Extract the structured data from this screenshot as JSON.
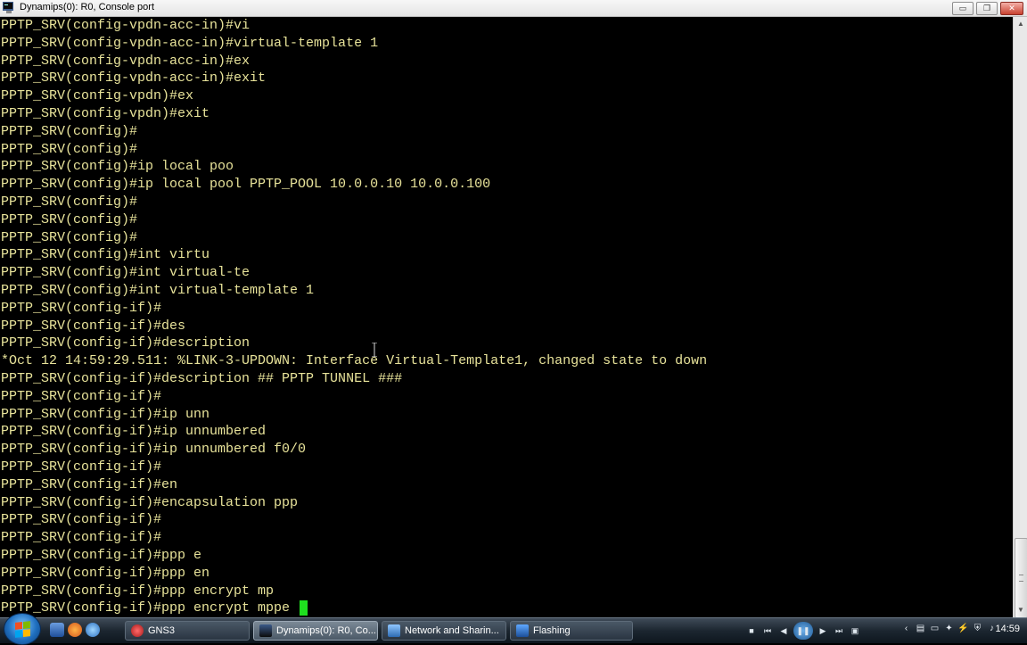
{
  "window": {
    "title": "Dynamips(0): R0, Console port",
    "minimize_glyph": "▭",
    "maximize_glyph": "❐",
    "close_glyph": "✕"
  },
  "console": {
    "lines": [
      "PPTP_SRV(config-vpdn-acc-in)#vi",
      "PPTP_SRV(config-vpdn-acc-in)#virtual-template 1",
      "PPTP_SRV(config-vpdn-acc-in)#ex",
      "PPTP_SRV(config-vpdn-acc-in)#exit",
      "PPTP_SRV(config-vpdn)#ex",
      "PPTP_SRV(config-vpdn)#exit",
      "PPTP_SRV(config)#",
      "PPTP_SRV(config)#",
      "PPTP_SRV(config)#ip local poo",
      "PPTP_SRV(config)#ip local pool PPTP_POOL 10.0.0.10 10.0.0.100",
      "PPTP_SRV(config)#",
      "PPTP_SRV(config)#",
      "PPTP_SRV(config)#",
      "PPTP_SRV(config)#int virtu",
      "PPTP_SRV(config)#int virtual-te",
      "PPTP_SRV(config)#int virtual-template 1",
      "PPTP_SRV(config-if)#",
      "PPTP_SRV(config-if)#des",
      "PPTP_SRV(config-if)#description",
      "*Oct 12 14:59:29.511: %LINK-3-UPDOWN: Interface Virtual-Template1, changed state to down",
      "PPTP_SRV(config-if)#description ## PPTP TUNNEL ###",
      "PPTP_SRV(config-if)#",
      "PPTP_SRV(config-if)#ip unn",
      "PPTP_SRV(config-if)#ip unnumbered",
      "PPTP_SRV(config-if)#ip unnumbered f0/0",
      "PPTP_SRV(config-if)#",
      "PPTP_SRV(config-if)#en",
      "PPTP_SRV(config-if)#encapsulation ppp",
      "PPTP_SRV(config-if)#",
      "PPTP_SRV(config-if)#",
      "PPTP_SRV(config-if)#ppp e",
      "PPTP_SRV(config-if)#ppp en",
      "PPTP_SRV(config-if)#ppp encrypt mp"
    ],
    "prompt_line": "PPTP_SRV(config-if)#ppp encrypt mppe ",
    "text_color": "#e8e39a",
    "cursor_color": "#1fe01f"
  },
  "taskbar": {
    "tasks": [
      {
        "label": "GNS3",
        "icon": "gns3-icon",
        "active": false
      },
      {
        "label": "Dynamips(0): R0, Co...",
        "icon": "terminal-icon",
        "active": true
      },
      {
        "label": "Network and Sharin...",
        "icon": "network-icon",
        "active": false
      },
      {
        "label": "Flashing",
        "icon": "flashing-icon",
        "active": false
      }
    ],
    "clock": "14:59"
  }
}
